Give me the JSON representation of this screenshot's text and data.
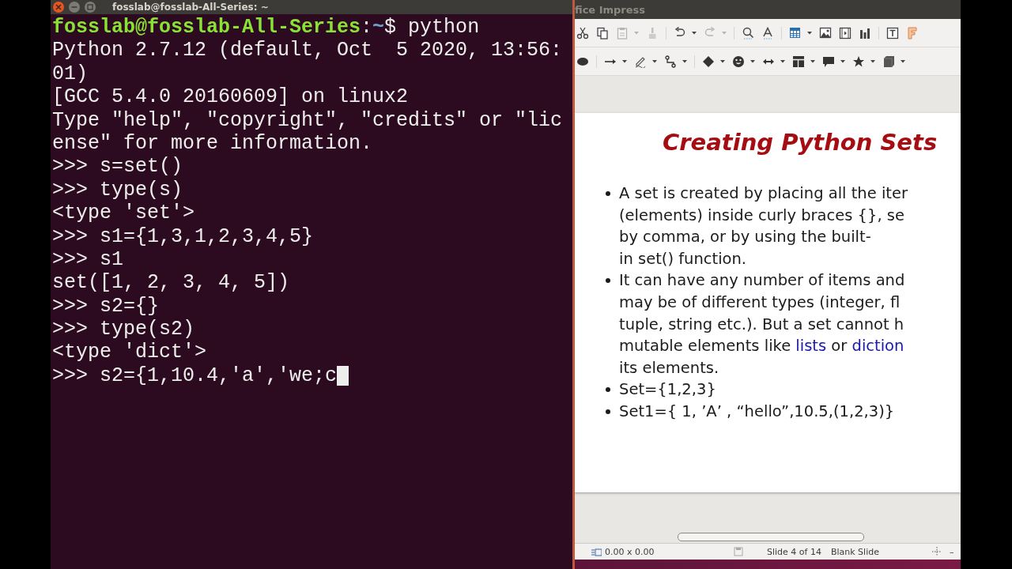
{
  "terminal": {
    "title": "fosslab@fosslab-All-Series: ~",
    "prompt": {
      "user": "fosslab@fosslab-All-Series",
      "separator": ":",
      "path": "~",
      "command": "$ python"
    },
    "lines": [
      "Python 2.7.12 (default, Oct  5 2020, 13:56:",
      "01)",
      "[GCC 5.4.0 20160609] on linux2",
      "Type \"help\", \"copyright\", \"credits\" or \"lic",
      "ense\" for more information.",
      ">>> s=set()",
      ">>> type(s)",
      "<type 'set'>",
      ">>> s1={1,3,1,2,3,4,5}",
      ">>> s1",
      "set([1, 2, 3, 4, 5])",
      ">>> s2={}",
      ">>> type(s2)",
      "<type 'dict'>",
      ">>> s2={1,10.4,'a','we;c"
    ],
    "cursor": true
  },
  "impress": {
    "title": "fice Impress",
    "toolbars": [
      [
        [
          {
            "kind": "cut",
            "disabled": false,
            "dropdown": false
          },
          {
            "kind": "copy",
            "disabled": false,
            "dropdown": false
          },
          {
            "kind": "paste",
            "disabled": true,
            "dropdown": true
          },
          {
            "kind": "clone",
            "disabled": true,
            "dropdown": false
          }
        ],
        [
          {
            "kind": "undo",
            "disabled": false,
            "dropdown": true
          },
          {
            "kind": "redo",
            "disabled": true,
            "dropdown": true
          }
        ],
        [
          {
            "kind": "find",
            "disabled": false,
            "dropdown": false
          },
          {
            "kind": "spelling",
            "disabled": false,
            "dropdown": false
          }
        ],
        [
          {
            "kind": "table",
            "disabled": false,
            "dropdown": true
          },
          {
            "kind": "image",
            "disabled": false,
            "dropdown": false
          },
          {
            "kind": "media",
            "disabled": false,
            "dropdown": false
          },
          {
            "kind": "chart",
            "disabled": false,
            "dropdown": false
          }
        ],
        [
          {
            "kind": "textbox",
            "disabled": false,
            "dropdown": false
          },
          {
            "kind": "fontwork",
            "disabled": false,
            "dropdown": false
          }
        ]
      ],
      [
        [
          {
            "kind": "ellipse",
            "disabled": false,
            "dropdown": false
          }
        ],
        [
          {
            "kind": "line",
            "disabled": false,
            "dropdown": true
          },
          {
            "kind": "curve",
            "disabled": false,
            "dropdown": true
          },
          {
            "kind": "connector",
            "disabled": false,
            "dropdown": true
          }
        ],
        [
          {
            "kind": "diamond",
            "disabled": false,
            "dropdown": true
          },
          {
            "kind": "smiley",
            "disabled": false,
            "dropdown": true
          },
          {
            "kind": "double-arrow",
            "disabled": false,
            "dropdown": true
          },
          {
            "kind": "flowchart",
            "disabled": false,
            "dropdown": true
          },
          {
            "kind": "callout",
            "disabled": false,
            "dropdown": true
          },
          {
            "kind": "star",
            "disabled": false,
            "dropdown": true
          },
          {
            "kind": "cube",
            "disabled": false,
            "dropdown": true
          }
        ]
      ]
    ],
    "slide": {
      "title": "Creating Python Sets",
      "bullets": [
        {
          "lines": [
            "A set is created by placing all the iter",
            "(elements) inside curly braces {}, se",
            "by comma, or by using the built-",
            "in set() function."
          ]
        },
        {
          "lines": [
            "It can have any number of items and",
            "may be of different types (integer, fl",
            "tuple, string etc.). But a set cannot h",
            [
              {
                "text": "mutable elements like ",
                "link": false
              },
              {
                "text": "lists",
                "link": true
              },
              {
                "text": " or ",
                "link": false
              },
              {
                "text": "diction",
                "link": true
              }
            ],
            "its elements."
          ]
        },
        {
          "lines": [
            "Set={1,2,3}"
          ]
        },
        {
          "lines": [
            "Set1={ 1, ’A’ , “hello”,10.5,(1,2,3)}"
          ]
        }
      ]
    },
    "status_bar": {
      "size": "0.00 x 0.00",
      "slide": "Slide 4 of 14",
      "layout": "Blank Slide",
      "zoom_out": "–"
    }
  }
}
